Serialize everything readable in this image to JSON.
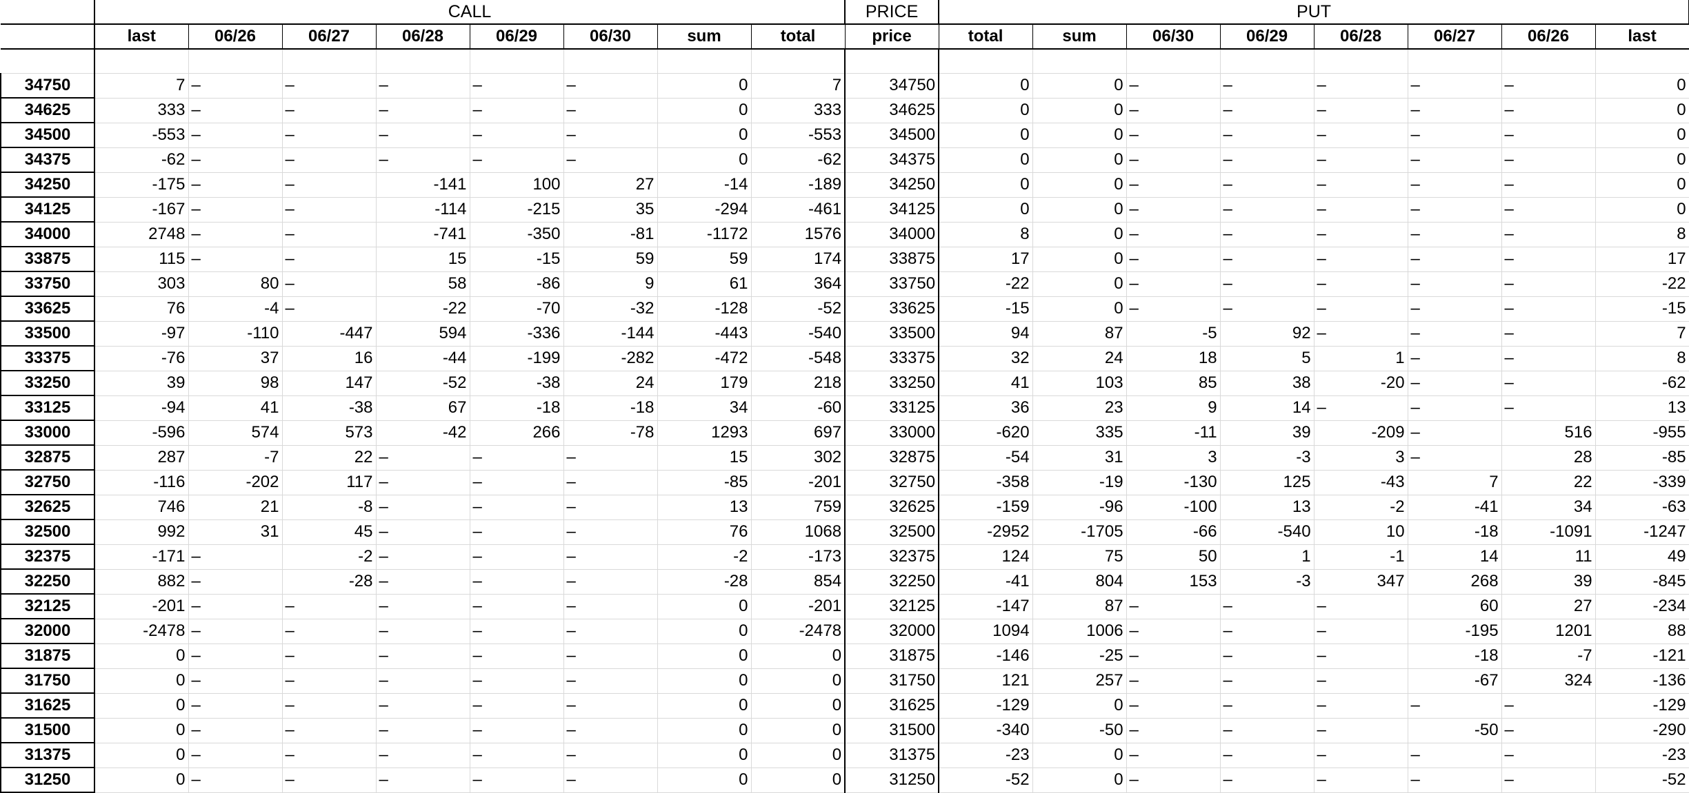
{
  "groups": [
    {
      "label": "",
      "span": 1
    },
    {
      "label": "CALL",
      "span": 8
    },
    {
      "label": "PRICE",
      "span": 1
    },
    {
      "label": "PUT",
      "span": 8
    }
  ],
  "columns": [
    "",
    "last",
    "06/26",
    "06/27",
    "06/28",
    "06/29",
    "06/30",
    "sum",
    "total",
    "price",
    "total",
    "sum",
    "06/30",
    "06/29",
    "06/28",
    "06/27",
    "06/26",
    "last"
  ],
  "rows": [
    [
      "34750",
      "7",
      "–",
      "–",
      "–",
      "–",
      "–",
      "0",
      "7",
      "34750",
      "0",
      "0",
      "–",
      "–",
      "–",
      "–",
      "–",
      "0"
    ],
    [
      "34625",
      "333",
      "–",
      "–",
      "–",
      "–",
      "–",
      "0",
      "333",
      "34625",
      "0",
      "0",
      "–",
      "–",
      "–",
      "–",
      "–",
      "0"
    ],
    [
      "34500",
      "-553",
      "–",
      "–",
      "–",
      "–",
      "–",
      "0",
      "-553",
      "34500",
      "0",
      "0",
      "–",
      "–",
      "–",
      "–",
      "–",
      "0"
    ],
    [
      "34375",
      "-62",
      "–",
      "–",
      "–",
      "–",
      "–",
      "0",
      "-62",
      "34375",
      "0",
      "0",
      "–",
      "–",
      "–",
      "–",
      "–",
      "0"
    ],
    [
      "34250",
      "-175",
      "–",
      "–",
      "-141",
      "100",
      "27",
      "-14",
      "-189",
      "34250",
      "0",
      "0",
      "–",
      "–",
      "–",
      "–",
      "–",
      "0"
    ],
    [
      "34125",
      "-167",
      "–",
      "–",
      "-114",
      "-215",
      "35",
      "-294",
      "-461",
      "34125",
      "0",
      "0",
      "–",
      "–",
      "–",
      "–",
      "–",
      "0"
    ],
    [
      "34000",
      "2748",
      "–",
      "–",
      "-741",
      "-350",
      "-81",
      "-1172",
      "1576",
      "34000",
      "8",
      "0",
      "–",
      "–",
      "–",
      "–",
      "–",
      "8"
    ],
    [
      "33875",
      "115",
      "–",
      "–",
      "15",
      "-15",
      "59",
      "59",
      "174",
      "33875",
      "17",
      "0",
      "–",
      "–",
      "–",
      "–",
      "–",
      "17"
    ],
    [
      "33750",
      "303",
      "80",
      "–",
      "58",
      "-86",
      "9",
      "61",
      "364",
      "33750",
      "-22",
      "0",
      "–",
      "–",
      "–",
      "–",
      "–",
      "-22"
    ],
    [
      "33625",
      "76",
      "-4",
      "–",
      "-22",
      "-70",
      "-32",
      "-128",
      "-52",
      "33625",
      "-15",
      "0",
      "–",
      "–",
      "–",
      "–",
      "–",
      "-15"
    ],
    [
      "33500",
      "-97",
      "-110",
      "-447",
      "594",
      "-336",
      "-144",
      "-443",
      "-540",
      "33500",
      "94",
      "87",
      "-5",
      "92",
      "–",
      "–",
      "–",
      "7"
    ],
    [
      "33375",
      "-76",
      "37",
      "16",
      "-44",
      "-199",
      "-282",
      "-472",
      "-548",
      "33375",
      "32",
      "24",
      "18",
      "5",
      "1",
      "–",
      "–",
      "8"
    ],
    [
      "33250",
      "39",
      "98",
      "147",
      "-52",
      "-38",
      "24",
      "179",
      "218",
      "33250",
      "41",
      "103",
      "85",
      "38",
      "-20",
      "–",
      "–",
      "-62"
    ],
    [
      "33125",
      "-94",
      "41",
      "-38",
      "67",
      "-18",
      "-18",
      "34",
      "-60",
      "33125",
      "36",
      "23",
      "9",
      "14",
      "–",
      "–",
      "–",
      "13"
    ],
    [
      "33000",
      "-596",
      "574",
      "573",
      "-42",
      "266",
      "-78",
      "1293",
      "697",
      "33000",
      "-620",
      "335",
      "-11",
      "39",
      "-209",
      "–",
      "516",
      "-955"
    ],
    [
      "32875",
      "287",
      "-7",
      "22",
      "–",
      "–",
      "–",
      "15",
      "302",
      "32875",
      "-54",
      "31",
      "3",
      "-3",
      "3",
      "–",
      "28",
      "-85"
    ],
    [
      "32750",
      "-116",
      "-202",
      "117",
      "–",
      "–",
      "–",
      "-85",
      "-201",
      "32750",
      "-358",
      "-19",
      "-130",
      "125",
      "-43",
      "7",
      "22",
      "-339"
    ],
    [
      "32625",
      "746",
      "21",
      "-8",
      "–",
      "–",
      "–",
      "13",
      "759",
      "32625",
      "-159",
      "-96",
      "-100",
      "13",
      "-2",
      "-41",
      "34",
      "-63"
    ],
    [
      "32500",
      "992",
      "31",
      "45",
      "–",
      "–",
      "–",
      "76",
      "1068",
      "32500",
      "-2952",
      "-1705",
      "-66",
      "-540",
      "10",
      "-18",
      "-1091",
      "-1247"
    ],
    [
      "32375",
      "-171",
      "–",
      "-2",
      "–",
      "–",
      "–",
      "-2",
      "-173",
      "32375",
      "124",
      "75",
      "50",
      "1",
      "-1",
      "14",
      "11",
      "49"
    ],
    [
      "32250",
      "882",
      "–",
      "-28",
      "–",
      "–",
      "–",
      "-28",
      "854",
      "32250",
      "-41",
      "804",
      "153",
      "-3",
      "347",
      "268",
      "39",
      "-845"
    ],
    [
      "32125",
      "-201",
      "–",
      "–",
      "–",
      "–",
      "–",
      "0",
      "-201",
      "32125",
      "-147",
      "87",
      "–",
      "–",
      "–",
      "60",
      "27",
      "-234"
    ],
    [
      "32000",
      "-2478",
      "–",
      "–",
      "–",
      "–",
      "–",
      "0",
      "-2478",
      "32000",
      "1094",
      "1006",
      "–",
      "–",
      "–",
      "-195",
      "1201",
      "88"
    ],
    [
      "31875",
      "0",
      "–",
      "–",
      "–",
      "–",
      "–",
      "0",
      "0",
      "31875",
      "-146",
      "-25",
      "–",
      "–",
      "–",
      "-18",
      "-7",
      "-121"
    ],
    [
      "31750",
      "0",
      "–",
      "–",
      "–",
      "–",
      "–",
      "0",
      "0",
      "31750",
      "121",
      "257",
      "–",
      "–",
      "–",
      "-67",
      "324",
      "-136"
    ],
    [
      "31625",
      "0",
      "–",
      "–",
      "–",
      "–",
      "–",
      "0",
      "0",
      "31625",
      "-129",
      "0",
      "–",
      "–",
      "–",
      "–",
      "–",
      "-129"
    ],
    [
      "31500",
      "0",
      "–",
      "–",
      "–",
      "–",
      "–",
      "0",
      "0",
      "31500",
      "-340",
      "-50",
      "–",
      "–",
      "–",
      "-50",
      "–",
      "-290"
    ],
    [
      "31375",
      "0",
      "–",
      "–",
      "–",
      "–",
      "–",
      "0",
      "0",
      "31375",
      "-23",
      "0",
      "–",
      "–",
      "–",
      "–",
      "–",
      "-23"
    ],
    [
      "31250",
      "0",
      "–",
      "–",
      "–",
      "–",
      "–",
      "0",
      "0",
      "31250",
      "-52",
      "0",
      "–",
      "–",
      "–",
      "–",
      "–",
      "-52"
    ]
  ]
}
